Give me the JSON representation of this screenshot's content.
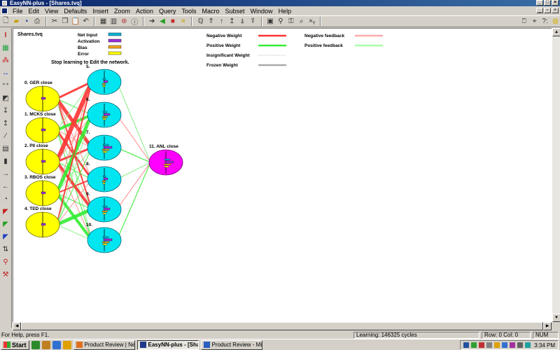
{
  "window": {
    "title": "EasyNN-plus - [Shares.tvq]"
  },
  "menu": [
    "File",
    "Edit",
    "View",
    "Defaults",
    "Insert",
    "Zoom",
    "Action",
    "Query",
    "Tools",
    "Macro",
    "Subset",
    "Window",
    "Help"
  ],
  "toolbar_icons": [
    "new-icon",
    "open-icon",
    "save-icon",
    "print-icon",
    "cut-icon",
    "copy-icon",
    "paste-icon",
    "undo-icon",
    "grid-icon",
    "columns-icon",
    "network-icon",
    "info-icon",
    "forward-icon",
    "start-learning-icon",
    "stop-icon",
    "query-icon",
    "sensitivity-icon",
    "up-icon",
    "up-alt-icon",
    "up-step-icon",
    "filter-icon",
    "tools-icon",
    "disk-icon",
    "wrench-icon",
    "key-icon",
    "find-icon",
    "xy-icon",
    "help-icon",
    "pointer-icon",
    "doc-icon",
    "whats-this-icon",
    "comment-icon"
  ],
  "left_tools": [
    "insert-icon",
    "grid-icon",
    "connect-icon",
    "arrows-icon",
    "plus-icon",
    "graph-icon",
    "down-icon",
    "up-icon",
    "line-icon",
    "chart-icon",
    "bar-icon",
    "arrow-right-icon",
    "arrow-left-icon",
    "pie-icon",
    "triangle-red-icon",
    "triangle-green-icon",
    "triangle-blue-icon",
    "updown-icon",
    "magnify-icon",
    "tool-icon"
  ],
  "network": {
    "file_label": "Shares.tvq",
    "message": "Stop learning to Edit the network.",
    "bar_legend": [
      {
        "label": "Net Input",
        "color": "#00b4d8"
      },
      {
        "label": "Activation",
        "color": "#9b30d9"
      },
      {
        "label": "Bias",
        "color": "#f5a623"
      },
      {
        "label": "Error",
        "color": "#ffff00"
      }
    ],
    "weight_legend": [
      {
        "label": "Negative Weight",
        "color": "#ff3333",
        "style": "solid"
      },
      {
        "label": "Positive Weight",
        "color": "#33ee33",
        "style": "solid"
      },
      {
        "label": "Insignificant Weight",
        "color": "#999999",
        "style": "dotted"
      },
      {
        "label": "Frozen Weight",
        "color": "#aaaaaa",
        "style": "solid-gray"
      }
    ],
    "feedback_legend": [
      {
        "label": "Negative feedback",
        "color": "#ffaaaa"
      },
      {
        "label": "Positive feedback",
        "color": "#aaffaa"
      }
    ],
    "input_nodes": [
      "0. GER close",
      "1. MCKS close",
      "2. PII close",
      "3. RBOS close",
      "4. TED close"
    ],
    "hidden_nodes": [
      "5.",
      "6.",
      "7.",
      "8.",
      "9.",
      "10."
    ],
    "output_node": "11. ANL close"
  },
  "status": {
    "help": "For Help, press F1.",
    "learning": "Learning:  146325 cycles",
    "rowcol": "Row: 0  Col: 0",
    "num": "NUM"
  },
  "taskbar": {
    "start": "Start",
    "tasks": [
      {
        "label": "Product Review | Neural ...",
        "active": false,
        "color": "#e07020"
      },
      {
        "label": "EasyNN-plus - [Shares...",
        "active": true,
        "color": "#1f3a8a"
      },
      {
        "label": "Product Review - Micros...",
        "active": false,
        "color": "#2a60c0"
      }
    ],
    "clock": "3:34 PM"
  }
}
